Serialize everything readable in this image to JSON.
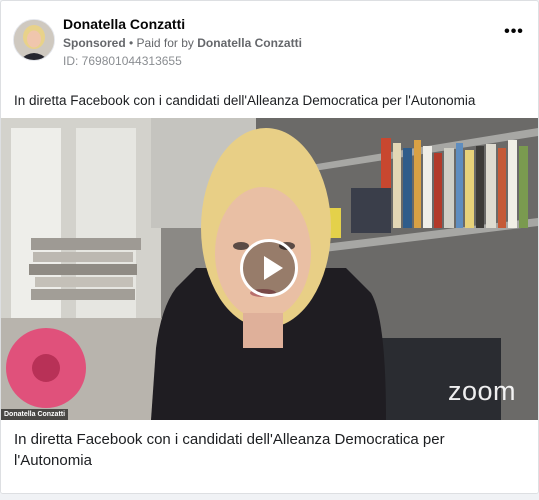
{
  "post": {
    "page_name": "Donatella Conzatti",
    "sponsored_label": "Sponsored",
    "separator": " • ",
    "paid_for_prefix": "Paid for by ",
    "paid_for_name": "Donatella Conzatti",
    "ad_id": "ID: 769801044313655",
    "more_icon": "more-horizontal-icon",
    "body_text": "In diretta Facebook con i candidati dell'Alleanza Democratica per l'Autonomia"
  },
  "video": {
    "watermark": "zoom",
    "speaker_tag": "Donatella Conzatti",
    "play_icon": "play-icon"
  },
  "link": {
    "caption": "In diretta Facebook con i candidati dell'Alleanza Democratica per l'Autonomia"
  },
  "colors": {
    "name": "#050505",
    "meta": "#65676b",
    "border": "#dddfe2"
  }
}
